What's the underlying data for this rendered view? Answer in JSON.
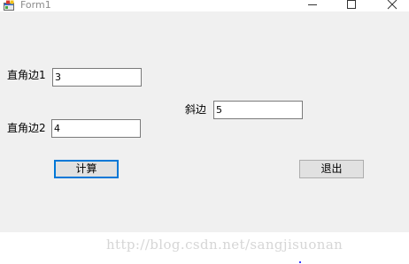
{
  "window": {
    "title": "Form1",
    "icon": "winforms-app-icon",
    "controls": {
      "minimize_icon": "minimize-icon",
      "maximize_icon": "maximize-icon",
      "close_icon": "close-icon"
    }
  },
  "form": {
    "leg1": {
      "label": "直角边1",
      "value": "3"
    },
    "leg2": {
      "label": "直角边2",
      "value": "4"
    },
    "hypotenuse": {
      "label": "斜边",
      "value": "5"
    },
    "calculate_label": "计算",
    "exit_label": "退出"
  },
  "watermark": "http://blog.csdn.net/sangjisuonan",
  "colors": {
    "form_background": "#f0f0f0",
    "focus_border": "#0078d7",
    "button_face": "#e1e1e1"
  }
}
